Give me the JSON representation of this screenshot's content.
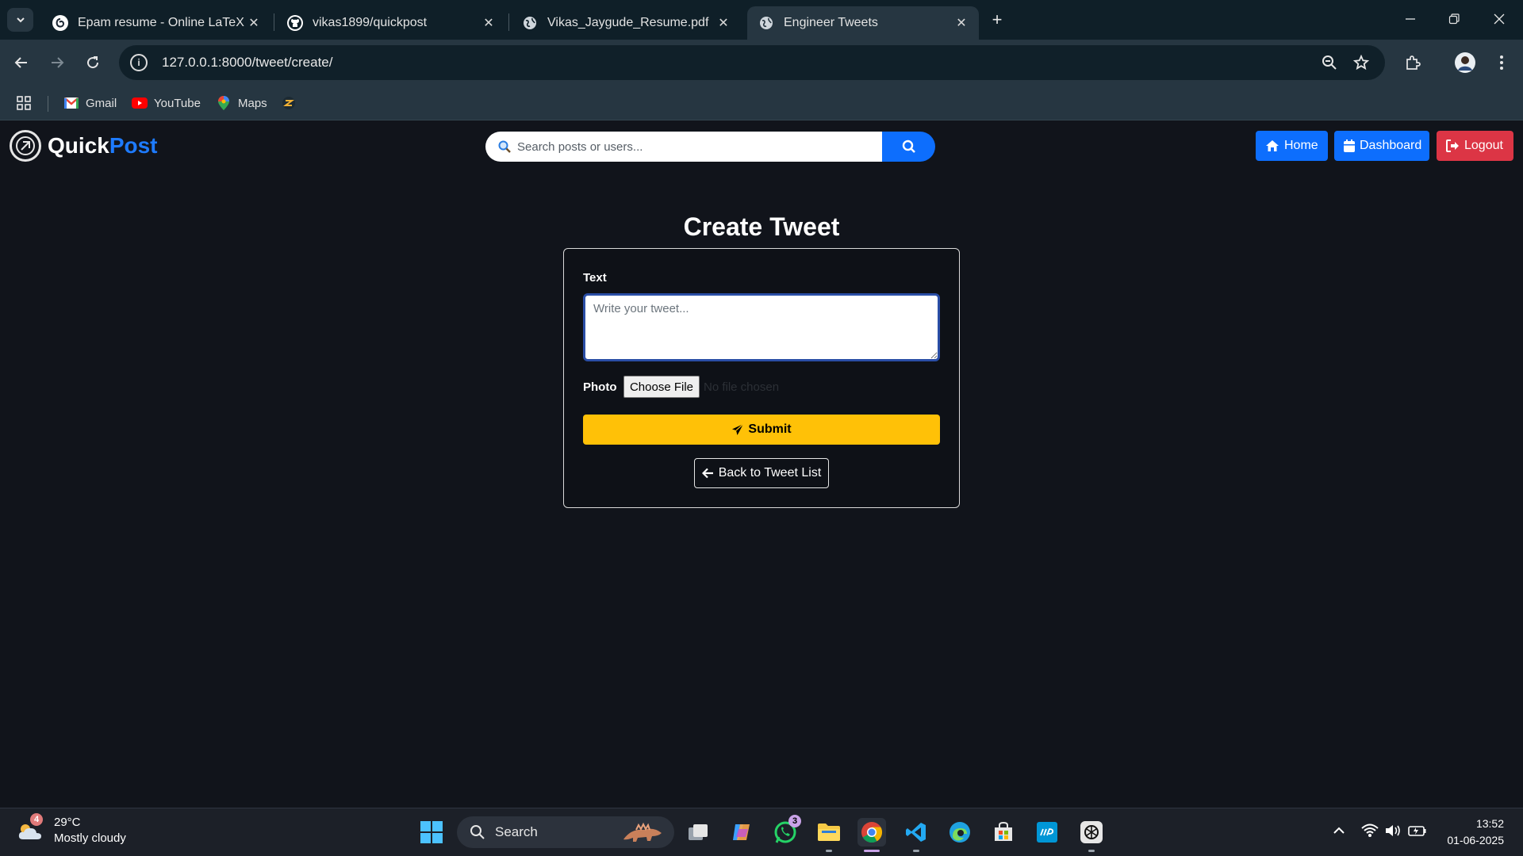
{
  "browser": {
    "tabs": [
      {
        "label": "Epam resume - Online LaTeX Ed",
        "favicon": "overleaf-icon",
        "active": false
      },
      {
        "label": "vikas1899/quickpost",
        "favicon": "github-icon",
        "active": false
      },
      {
        "label": "Vikas_Jaygude_Resume.pdf",
        "favicon": "globe-icon",
        "active": false
      },
      {
        "label": "Engineer Tweets",
        "favicon": "globe-icon",
        "active": true
      }
    ],
    "url": "127.0.0.1:8000/tweet/create/",
    "bookmarks": [
      {
        "label": "Gmail",
        "icon": "gmail-icon"
      },
      {
        "label": "YouTube",
        "icon": "youtube-icon"
      },
      {
        "label": "Maps",
        "icon": "maps-icon"
      }
    ]
  },
  "app": {
    "brand": {
      "part1": "Quick",
      "part2": "Post"
    },
    "search": {
      "placeholder": "Search posts or users..."
    },
    "nav": {
      "home": "Home",
      "dashboard": "Dashboard",
      "logout": "Logout"
    },
    "colors": {
      "home": "#0d6efd",
      "dashboard": "#0d6efd",
      "logout": "#dc3545",
      "submit": "#ffc107",
      "brand_accent": "#1e7bff"
    }
  },
  "form": {
    "title": "Create Tweet",
    "text_label": "Text",
    "text_placeholder": "Write your tweet...",
    "photo_label": "Photo",
    "file_button": "Choose File",
    "file_status": "No file chosen",
    "submit_label": "Submit",
    "back_label": "Back to Tweet List"
  },
  "taskbar": {
    "weather": {
      "temp": "29°C",
      "condition": "Mostly cloudy",
      "badge": "4"
    },
    "search_label": "Search",
    "whatsapp_badge": "3",
    "time": "13:52",
    "date": "01-06-2025"
  }
}
